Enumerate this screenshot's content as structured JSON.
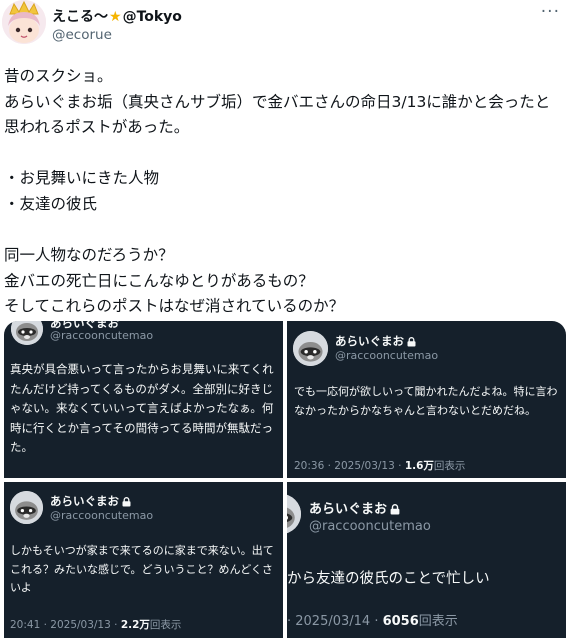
{
  "author": {
    "display_name": "えこる〜",
    "star": "★",
    "display_suffix": "@Tokyo",
    "handle": "@ecorue"
  },
  "more_icon": "more-horizontal-icon",
  "body": {
    "line1": "昔のスクショ。",
    "line2": "あらいぐまお垢（真央さんサブ垢）で金バエさんの命日3/13に誰かと会ったと思われるポストがあった。",
    "line3": "・お見舞いにきた人物",
    "line4": "・友達の彼氏",
    "line5": "同一人物なのだろうか？",
    "line6": "金バエの死亡日にこんなゆとりがあるもの？",
    "line7": "そしてこれらのポストはなぜ消されているのか？"
  },
  "screenshots": [
    {
      "name": "あらいぐまお",
      "handle": "@raccooncutemao",
      "text": "真央が具合悪いって言ったからお見舞いに来てくれたんだけど持ってくるものがダメ。全部別に好きじゃない。来なくていいって言えばよかったなぁ。何時に行くとか言ってその間待ってる時間が無駄だった。",
      "time": "",
      "views": "",
      "views_label": ""
    },
    {
      "name": "あらいぐまお",
      "handle": "@raccooncutemao",
      "text": "でも一応何が欲しいって聞かれたんだよね。特に言わなかったからかなちゃんと言わないとだめだね。",
      "time": "20:36 · 2025/03/13 · ",
      "views": "1.6万",
      "views_label": "回表示"
    },
    {
      "name": "あらいぐまお",
      "handle": "@raccooncutemao",
      "text": "しかもそいつが家まで来てるのに家まで来ない。出てこれる？みたいな感じで。どういうこと？めんどくさいよ",
      "time": "20:41 · 2025/03/13 · ",
      "views": "2.2万",
      "views_label": "回表示"
    },
    {
      "name": "あらいぐまお",
      "handle": "@raccooncutemao",
      "text": "から友達の彼氏のことで忙しい",
      "time": "· 2025/03/14 · ",
      "views": "6056",
      "views_label": "回表示"
    }
  ]
}
